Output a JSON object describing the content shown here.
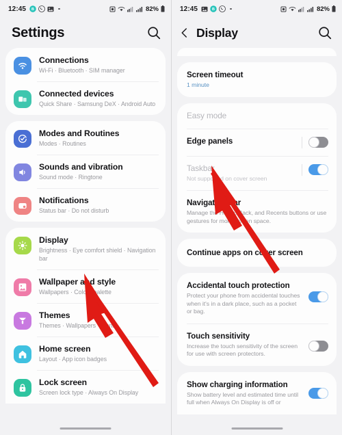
{
  "status_bar": {
    "time": "12:45",
    "left_icons": [
      "whatsapp-business-icon",
      "whatsapp-icon",
      "gallery-icon",
      "more-dot-icon"
    ],
    "right_icons": [
      "alarm-icon",
      "wifi-calling-icon",
      "signal-bars-icon",
      "cellular-bars-icon"
    ],
    "battery_percent": "82%"
  },
  "left_panel": {
    "header": {
      "title": "Settings",
      "search_icon": "search-icon"
    },
    "groups": [
      {
        "items": [
          {
            "title": "Connections",
            "subtitle": "Wi-Fi  ·  Bluetooth  ·  SIM manager",
            "icon": "wifi-icon",
            "icon_color": "#4a90e2"
          },
          {
            "title": "Connected devices",
            "subtitle": "Quick Share  ·  Samsung DeX  ·  Android Auto",
            "icon": "connected-devices-icon",
            "icon_color": "#3ec6ae"
          }
        ]
      },
      {
        "items": [
          {
            "title": "Modes and Routines",
            "subtitle": "Modes  ·  Routines",
            "icon": "modes-routines-icon",
            "icon_color": "#4a6fd4"
          },
          {
            "title": "Sounds and vibration",
            "subtitle": "Sound mode  ·  Ringtone",
            "icon": "sound-icon",
            "icon_color": "#8186e0"
          },
          {
            "title": "Notifications",
            "subtitle": "Status bar  ·  Do not disturb",
            "icon": "notifications-icon",
            "icon_color": "#ef8484"
          }
        ]
      },
      {
        "items": [
          {
            "title": "Display",
            "subtitle": "Brightness  ·  Eye comfort shield  ·  Navigation bar",
            "icon": "display-brightness-icon",
            "icon_color": "#a6d94a"
          },
          {
            "title": "Wallpaper and style",
            "subtitle": "Wallpapers  ·  Colour palette",
            "icon": "wallpaper-icon",
            "icon_color": "#ef7ba8"
          },
          {
            "title": "Themes",
            "subtitle": "Themes  ·  Wallpapers  ·  Icons",
            "icon": "themes-brush-icon",
            "icon_color": "#c879e0"
          },
          {
            "title": "Home screen",
            "subtitle": "Layout  ·  App icon badges",
            "icon": "home-screen-icon",
            "icon_color": "#3fc1e0"
          },
          {
            "title": "Lock screen",
            "subtitle": "Screen lock type  ·  Always On Display",
            "icon": "lock-icon",
            "icon_color": "#2ec4a0"
          }
        ]
      }
    ]
  },
  "right_panel": {
    "header": {
      "title": "Display",
      "back_icon": "back-chevron-icon",
      "search_icon": "search-icon"
    },
    "items": [
      {
        "title": "Screen timeout",
        "subtitle": "1 minute",
        "subtitle_style": "accent",
        "toggle": null,
        "group": 1
      },
      {
        "title": "Easy mode",
        "subtitle": "",
        "title_style": "dim",
        "toggle": null,
        "group": 2
      },
      {
        "title": "Edge panels",
        "subtitle": "",
        "toggle": "off",
        "group": 2
      },
      {
        "title": "Taskbar",
        "subtitle": "Not supported on cover screen",
        "title_style": "dim",
        "subtitle_style": "dim",
        "toggle": "on",
        "group": 2
      },
      {
        "title": "Navigation bar",
        "subtitle": "Manage the Home, Back, and Recents buttons or use gestures for more screen space.",
        "toggle": null,
        "group": 2
      },
      {
        "title": "Continue apps on cover screen",
        "subtitle": "",
        "toggle": null,
        "group": 3
      },
      {
        "title": "Accidental touch protection",
        "subtitle": "Protect your phone from accidental touches when it's in a dark place, such as a pocket or bag.",
        "toggle": "on",
        "group": 4
      },
      {
        "title": "Touch sensitivity",
        "subtitle": "Increase the touch sensitivity of the screen for use with screen protectors.",
        "toggle": "off",
        "group": 4
      },
      {
        "title": "Show charging information",
        "subtitle": "Show battery level and estimated time until full when Always On Display is off or",
        "toggle": "on",
        "group": 5
      }
    ]
  },
  "annotations": {
    "arrow_color": "#e01b15",
    "left_arrow_label": "pointer-arrow-to-display",
    "right_arrow_label": "pointer-arrow-to-edge-panels"
  }
}
